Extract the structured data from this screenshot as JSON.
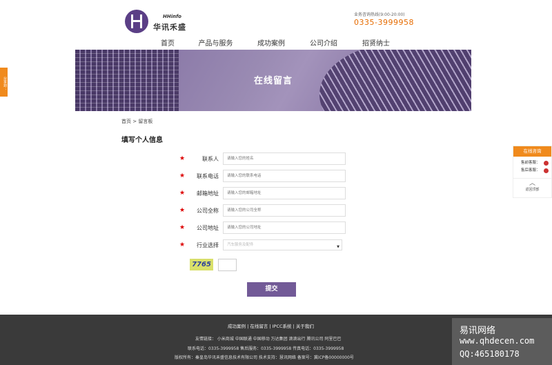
{
  "header": {
    "brand_en": "HHinfo",
    "brand_cn": "华讯禾盛",
    "hotline_label": "业务咨询热线(9:00-20:00)",
    "hotline_number": "0335-3999958",
    "nav": [
      "首页",
      "产品与服务",
      "成功案例",
      "公司介绍",
      "招贤纳士"
    ]
  },
  "banner": {
    "title": "在线留言"
  },
  "breadcrumb": "首页 > 留言板",
  "section_title": "填写个人信息",
  "form": {
    "fields": [
      {
        "label": "联系人",
        "placeholder": "请输入您的姓名"
      },
      {
        "label": "联系电话",
        "placeholder": "请输入您的联系电话"
      },
      {
        "label": "邮箱地址",
        "placeholder": "请输入您的邮箱地址"
      },
      {
        "label": "公司全称",
        "placeholder": "请输入您的公司全称"
      },
      {
        "label": "公司地址",
        "placeholder": "请输入您的公司地址"
      }
    ],
    "industry_label": "行业选择",
    "industry_value": "汽车服务及配件",
    "captcha": "7765",
    "submit": "提交"
  },
  "footer": {
    "links": "成功案例 | 在线留言 | IPCC系统 | 关于我们",
    "friends": "友情链接： 小米商城 中国联通 中国移动 万达集团 滴滴出行 腾讯公司 阿里巴巴",
    "contact": "联系电话：0335-3999958      售后服务：0335-3999958      传真电话：0335-3999958",
    "copyright": "版权所有：秦皇岛华讯禾盛信息技术有限公司  技术支持：慧讯网络    备案号：冀ICP备00000000号"
  },
  "watermark": {
    "line1": "易讯网络",
    "line2": "www.qhdecen.com",
    "line3": "QQ:465180178"
  },
  "share_tab": "分享到：",
  "service_panel": {
    "title": "在线咨询",
    "items": [
      "售前客服：",
      "售后客服："
    ],
    "top": "返回顶部"
  },
  "colors": {
    "accent": "#725a97",
    "orange": "#f08a1c",
    "footer_bg": "#3a3a3a"
  }
}
